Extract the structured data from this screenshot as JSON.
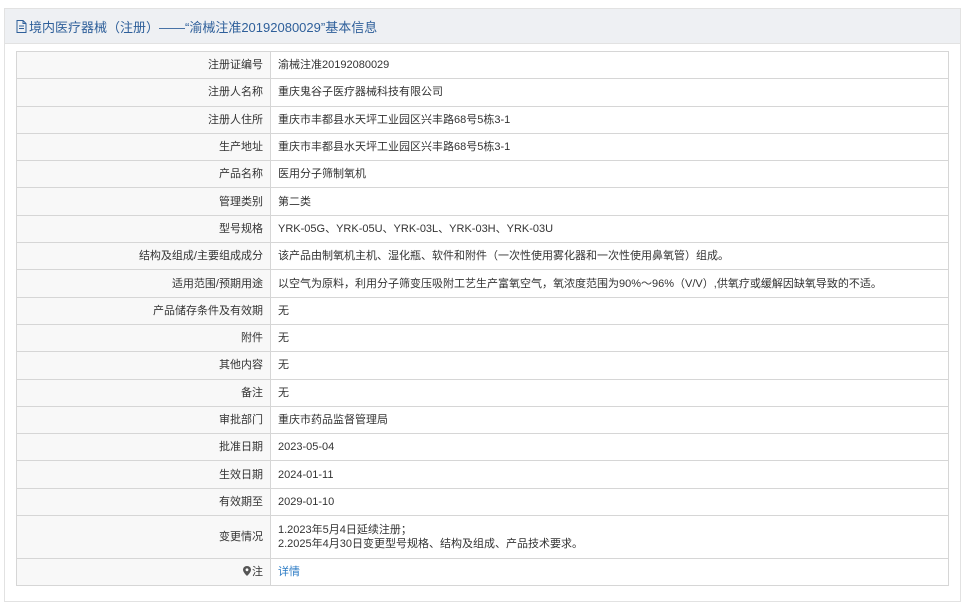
{
  "header": {
    "title": "境内医疗器械（注册）——“渝械注准20192080029”基本信息",
    "icon": "document-icon",
    "title_color": "#2e5f9a"
  },
  "rows": [
    {
      "label": "注册证编号",
      "value": "渝械注准20192080029"
    },
    {
      "label": "注册人名称",
      "value": "重庆鬼谷子医疗器械科技有限公司"
    },
    {
      "label": "注册人住所",
      "value": "重庆市丰都县水天坪工业园区兴丰路68号5栋3-1"
    },
    {
      "label": "生产地址",
      "value": "重庆市丰都县水天坪工业园区兴丰路68号5栋3-1"
    },
    {
      "label": "产品名称",
      "value": "医用分子筛制氧机"
    },
    {
      "label": "管理类别",
      "value": "第二类"
    },
    {
      "label": "型号规格",
      "value": "YRK-05G、YRK-05U、YRK-03L、YRK-03H、YRK-03U"
    },
    {
      "label": "结构及组成/主要组成成分",
      "value": "该产品由制氧机主机、湿化瓶、软件和附件（一次性使用雾化器和一次性使用鼻氧管）组成。"
    },
    {
      "label": "适用范围/预期用途",
      "value": "以空气为原料，利用分子筛变压吸附工艺生产富氧空气，氧浓度范围为90%～96%（V/V）,供氧疗或缓解因缺氧导致的不适。"
    },
    {
      "label": "产品储存条件及有效期",
      "value": "无"
    },
    {
      "label": "附件",
      "value": "无"
    },
    {
      "label": "其他内容",
      "value": "无"
    },
    {
      "label": "备注",
      "value": "无"
    },
    {
      "label": "审批部门",
      "value": "重庆市药品监督管理局"
    },
    {
      "label": "批准日期",
      "value": "2023-05-04"
    },
    {
      "label": "生效日期",
      "value": "2024-01-11"
    },
    {
      "label": "有效期至",
      "value": "2029-01-10"
    }
  ],
  "changes": {
    "label": "变更情况",
    "lines": [
      "1.2023年5月4日延续注册；",
      "2.2025年4月30日变更型号规格、结构及组成、产品技术要求。"
    ]
  },
  "note": {
    "label": "注",
    "icon": "map-pin-icon",
    "link": "详情",
    "link_color": "#2a7ac4"
  }
}
